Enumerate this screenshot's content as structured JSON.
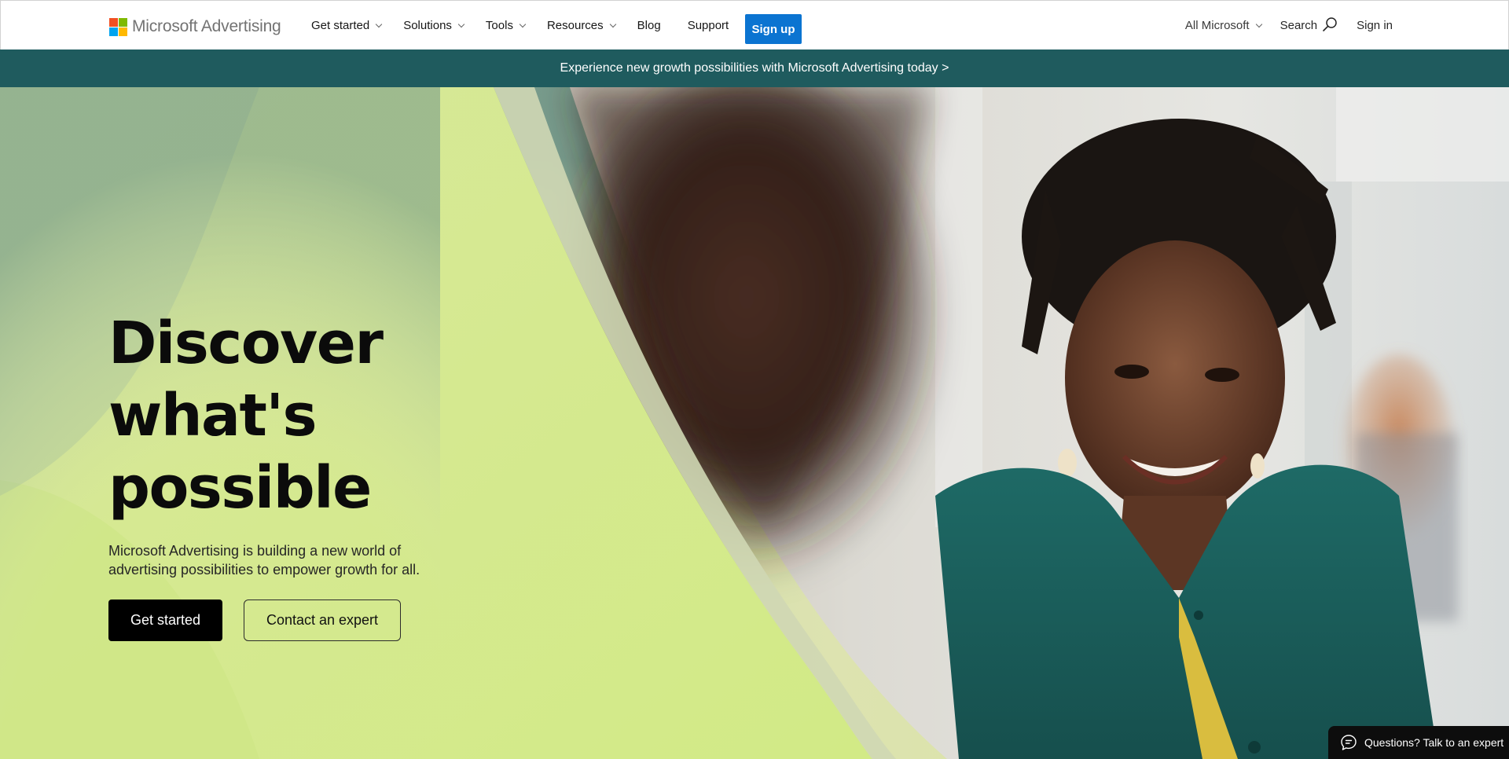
{
  "brand": {
    "name": "Microsoft Advertising",
    "logo_colors": [
      "#f25022",
      "#7fba00",
      "#00a4ef",
      "#ffb900"
    ]
  },
  "nav": {
    "items": [
      {
        "label": "Get started",
        "has_dropdown": true
      },
      {
        "label": "Solutions",
        "has_dropdown": true
      },
      {
        "label": "Tools",
        "has_dropdown": true
      },
      {
        "label": "Resources",
        "has_dropdown": true
      },
      {
        "label": "Blog",
        "has_dropdown": false
      },
      {
        "label": "Support",
        "has_dropdown": false
      }
    ],
    "signup_label": "Sign up",
    "signup_color": "#0b74d1"
  },
  "right_nav": {
    "all_microsoft": "All Microsoft",
    "search": "Search",
    "search_icon": "search-icon",
    "sign_in": "Sign in"
  },
  "promo_banner": {
    "text": "Experience new growth possibilities with Microsoft Advertising today >",
    "background": "#1f5b5e"
  },
  "hero": {
    "title_lines": [
      "Discover",
      "what's",
      "possible"
    ],
    "subtitle": "Microsoft Advertising is building a new world of advertising possibilities to empower growth for all.",
    "primary_cta": "Get started",
    "secondary_cta": "Contact an expert",
    "accent_green": "#d4ec8c",
    "image_description": "Smiling woman in a teal cardigan at a table, with a blurred person in foreground"
  },
  "chat_widget": {
    "label": "Questions? Talk to an expert",
    "icon": "chat-bubble-icon"
  }
}
